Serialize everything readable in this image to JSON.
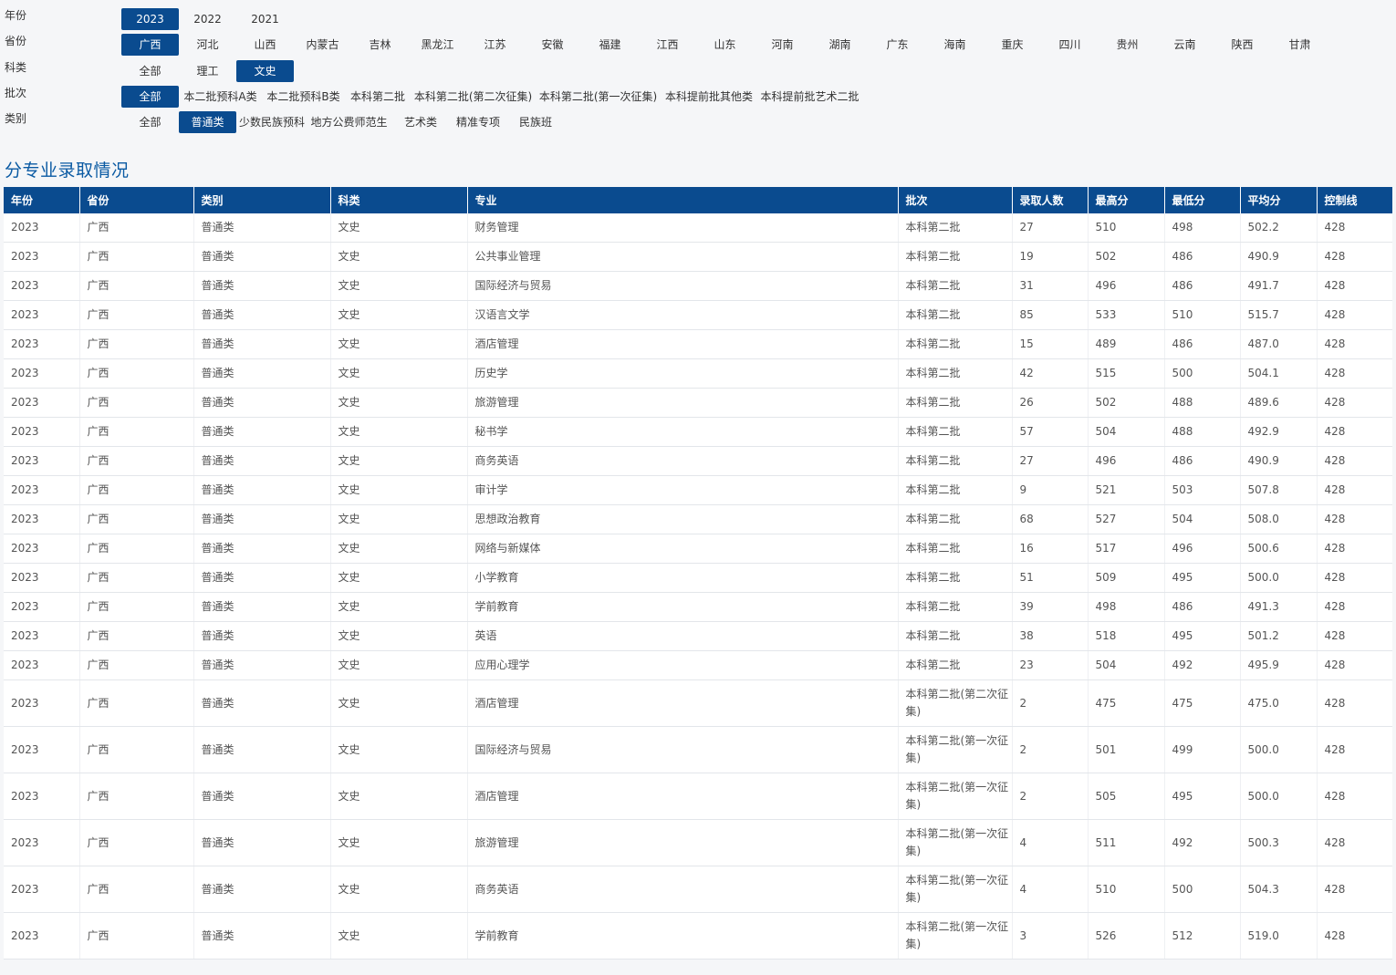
{
  "filters": [
    {
      "label": "年份",
      "name": "year",
      "options": [
        "2023",
        "2022",
        "2021"
      ],
      "active": 0
    },
    {
      "label": "省份",
      "name": "province",
      "options": [
        "广西",
        "河北",
        "山西",
        "内蒙古",
        "吉林",
        "黑龙江",
        "江苏",
        "安徽",
        "福建",
        "江西",
        "山东",
        "河南",
        "湖南",
        "广东",
        "海南",
        "重庆",
        "四川",
        "贵州",
        "云南",
        "陕西",
        "甘肃"
      ],
      "active": 0
    },
    {
      "label": "科类",
      "name": "subject",
      "options": [
        "全部",
        "理工",
        "文史"
      ],
      "active": 2
    },
    {
      "label": "批次",
      "name": "batch",
      "options": [
        "全部",
        "本二批预科A类",
        "本二批预科B类",
        "本科第二批",
        "本科第二批(第二次征集)",
        "本科第二批(第一次征集)",
        "本科提前批其他类",
        "本科提前批艺术二批"
      ],
      "active": 0
    },
    {
      "label": "类别",
      "name": "category",
      "options": [
        "全部",
        "普通类",
        "少数民族预科",
        "地方公费师范生",
        "艺术类",
        "精准专项",
        "民族班"
      ],
      "active": 1
    }
  ],
  "section_title": "分专业录取情况",
  "table": {
    "headers": [
      "年份",
      "省份",
      "类别",
      "科类",
      "专业",
      "批次",
      "录取人数",
      "最高分",
      "最低分",
      "平均分",
      "控制线"
    ],
    "rows": [
      [
        "2023",
        "广西",
        "普通类",
        "文史",
        "财务管理",
        "本科第二批",
        "27",
        "510",
        "498",
        "502.2",
        "428"
      ],
      [
        "2023",
        "广西",
        "普通类",
        "文史",
        "公共事业管理",
        "本科第二批",
        "19",
        "502",
        "486",
        "490.9",
        "428"
      ],
      [
        "2023",
        "广西",
        "普通类",
        "文史",
        "国际经济与贸易",
        "本科第二批",
        "31",
        "496",
        "486",
        "491.7",
        "428"
      ],
      [
        "2023",
        "广西",
        "普通类",
        "文史",
        "汉语言文学",
        "本科第二批",
        "85",
        "533",
        "510",
        "515.7",
        "428"
      ],
      [
        "2023",
        "广西",
        "普通类",
        "文史",
        "酒店管理",
        "本科第二批",
        "15",
        "489",
        "486",
        "487.0",
        "428"
      ],
      [
        "2023",
        "广西",
        "普通类",
        "文史",
        "历史学",
        "本科第二批",
        "42",
        "515",
        "500",
        "504.1",
        "428"
      ],
      [
        "2023",
        "广西",
        "普通类",
        "文史",
        "旅游管理",
        "本科第二批",
        "26",
        "502",
        "488",
        "489.6",
        "428"
      ],
      [
        "2023",
        "广西",
        "普通类",
        "文史",
        "秘书学",
        "本科第二批",
        "57",
        "504",
        "488",
        "492.9",
        "428"
      ],
      [
        "2023",
        "广西",
        "普通类",
        "文史",
        "商务英语",
        "本科第二批",
        "27",
        "496",
        "486",
        "490.9",
        "428"
      ],
      [
        "2023",
        "广西",
        "普通类",
        "文史",
        "审计学",
        "本科第二批",
        "9",
        "521",
        "503",
        "507.8",
        "428"
      ],
      [
        "2023",
        "广西",
        "普通类",
        "文史",
        "思想政治教育",
        "本科第二批",
        "68",
        "527",
        "504",
        "508.0",
        "428"
      ],
      [
        "2023",
        "广西",
        "普通类",
        "文史",
        "网络与新媒体",
        "本科第二批",
        "16",
        "517",
        "496",
        "500.6",
        "428"
      ],
      [
        "2023",
        "广西",
        "普通类",
        "文史",
        "小学教育",
        "本科第二批",
        "51",
        "509",
        "495",
        "500.0",
        "428"
      ],
      [
        "2023",
        "广西",
        "普通类",
        "文史",
        "学前教育",
        "本科第二批",
        "39",
        "498",
        "486",
        "491.3",
        "428"
      ],
      [
        "2023",
        "广西",
        "普通类",
        "文史",
        "英语",
        "本科第二批",
        "38",
        "518",
        "495",
        "501.2",
        "428"
      ],
      [
        "2023",
        "广西",
        "普通类",
        "文史",
        "应用心理学",
        "本科第二批",
        "23",
        "504",
        "492",
        "495.9",
        "428"
      ],
      [
        "2023",
        "广西",
        "普通类",
        "文史",
        "酒店管理",
        "本科第二批(第二次征集)",
        "2",
        "475",
        "475",
        "475.0",
        "428"
      ],
      [
        "2023",
        "广西",
        "普通类",
        "文史",
        "国际经济与贸易",
        "本科第二批(第一次征集)",
        "2",
        "501",
        "499",
        "500.0",
        "428"
      ],
      [
        "2023",
        "广西",
        "普通类",
        "文史",
        "酒店管理",
        "本科第二批(第一次征集)",
        "2",
        "505",
        "495",
        "500.0",
        "428"
      ],
      [
        "2023",
        "广西",
        "普通类",
        "文史",
        "旅游管理",
        "本科第二批(第一次征集)",
        "4",
        "511",
        "492",
        "500.3",
        "428"
      ],
      [
        "2023",
        "广西",
        "普通类",
        "文史",
        "商务英语",
        "本科第二批(第一次征集)",
        "4",
        "510",
        "500",
        "504.3",
        "428"
      ],
      [
        "2023",
        "广西",
        "普通类",
        "文史",
        "学前教育",
        "本科第二批(第一次征集)",
        "3",
        "526",
        "512",
        "519.0",
        "428"
      ]
    ]
  }
}
